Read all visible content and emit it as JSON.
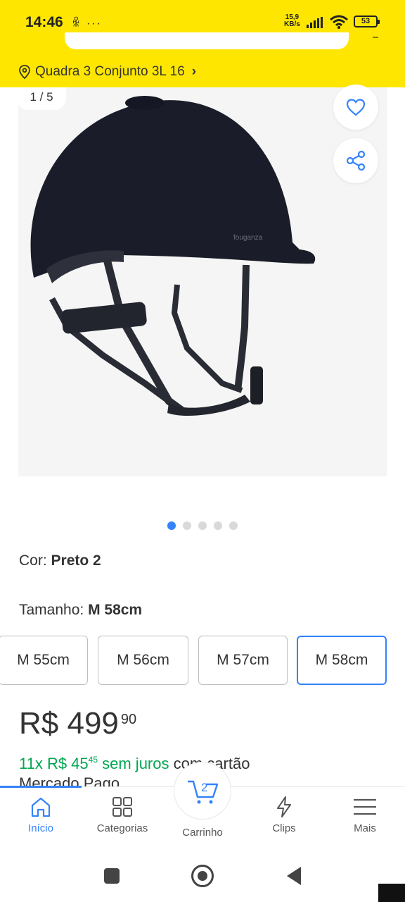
{
  "status_bar": {
    "time": "14:46",
    "left_icons": "ꆜ ···",
    "speed_value": "15,9",
    "speed_unit": "KB/s",
    "battery": "53"
  },
  "header": {
    "address": "Quadra 3 Conjunto 3L 16",
    "address_chevron": "›"
  },
  "gallery": {
    "counter": "1 / 5",
    "total_images": 5,
    "active_index": 0,
    "favorite_icon": "heart-icon",
    "share_icon": "share-icon"
  },
  "product": {
    "color_label": "Cor: ",
    "color_value": "Preto 2",
    "size_label": "Tamanho: ",
    "size_value": "M 58cm",
    "sizes": [
      "M 55cm",
      "M 56cm",
      "M 57cm",
      "M 58cm"
    ],
    "selected_size_index": 3,
    "price_main": "R$ 499",
    "price_cents": "90",
    "installment_prefix": "11x R$ 45",
    "installment_cents": "45",
    "installment_suffix": " sem juros",
    "installment_tail": " com cartão",
    "installment_line2": "Mercado Pago"
  },
  "bottom_nav": {
    "items": [
      {
        "label": "Início",
        "icon": "home-icon"
      },
      {
        "label": "Categorias",
        "icon": "grid-icon"
      },
      {
        "label": "Carrinho",
        "icon": "cart-icon"
      },
      {
        "label": "Clips",
        "icon": "bolt-icon"
      },
      {
        "label": "Mais",
        "icon": "menu-icon"
      }
    ],
    "cart_count": "2",
    "active_index": 0
  },
  "colors": {
    "brand_yellow": "#ffe600",
    "accent_blue": "#3483fa",
    "success_green": "#00a650"
  }
}
